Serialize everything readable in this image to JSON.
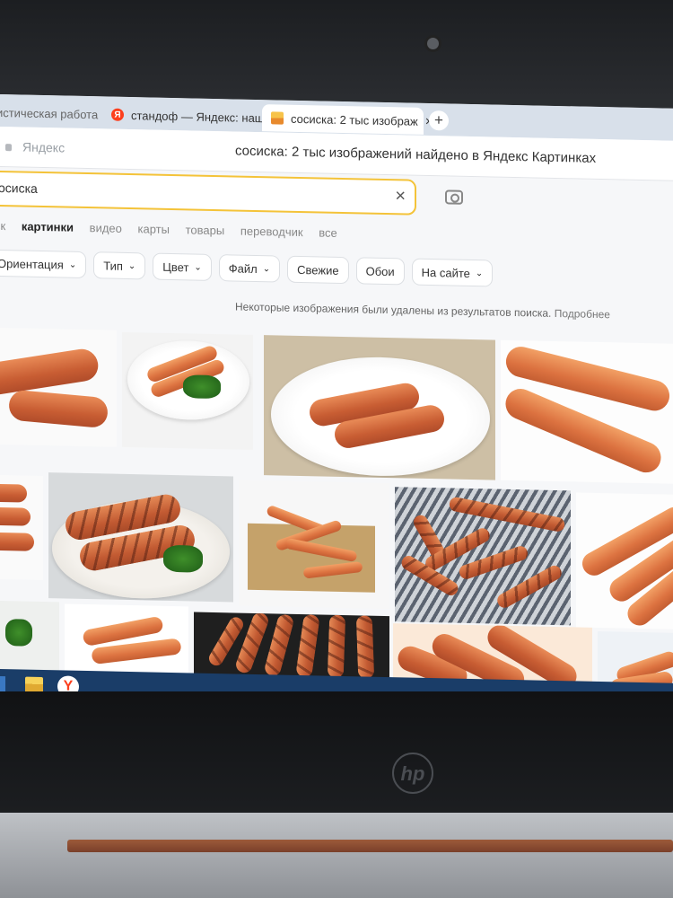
{
  "browser": {
    "tabs": [
      {
        "label": "тистическая работа",
        "active": false
      },
      {
        "label": "стандоф — Яндекс: нашл",
        "favicon": "Я",
        "active": false
      },
      {
        "label": "сосиска: 2 тыс изображ",
        "active": true,
        "close": "×"
      }
    ],
    "new_tab": "+",
    "address_brand": "Яндекс",
    "page_title": "сосиска: 2 тыс изображений найдено в Яндекс Картинках"
  },
  "search": {
    "value": "осиска",
    "clear": "×"
  },
  "nav": {
    "items": [
      "ск",
      "картинки",
      "видео",
      "карты",
      "товары",
      "переводчик",
      "все"
    ],
    "active_index": 1
  },
  "filters": {
    "items": [
      {
        "label": "Ориентация",
        "dropdown": true
      },
      {
        "label": "Тип",
        "dropdown": true
      },
      {
        "label": "Цвет",
        "dropdown": true
      },
      {
        "label": "Файл",
        "dropdown": true
      },
      {
        "label": "Свежие",
        "dropdown": false
      },
      {
        "label": "Обои",
        "dropdown": false
      },
      {
        "label": "На сайте",
        "dropdown": true
      }
    ],
    "chevron": "⌄"
  },
  "notice": {
    "text": "Некоторые изображения были удалены из результатов поиска.",
    "link": "Подробнее"
  },
  "taskbar": {
    "yandex_icon": "Y"
  },
  "hardware": {
    "brand_logo": "hp"
  },
  "colors": {
    "accent_search": "#f4c339",
    "yandex_red": "#fc3f1d",
    "taskbar": "#1a3d68"
  }
}
